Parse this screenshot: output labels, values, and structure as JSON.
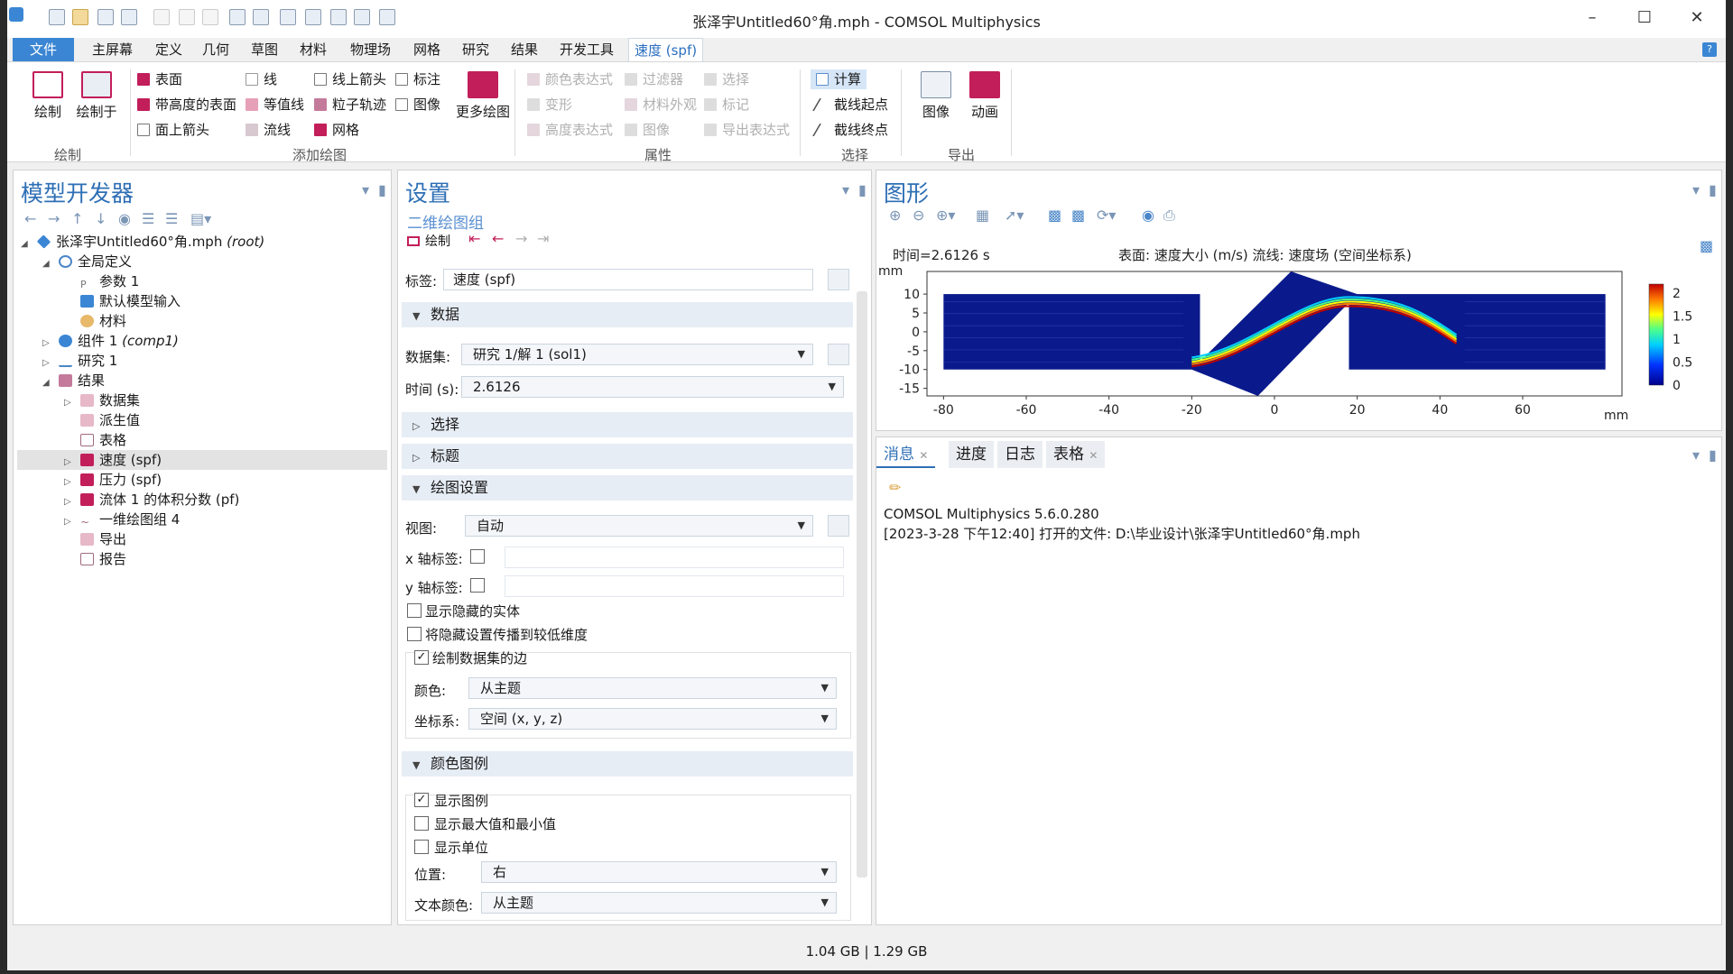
{
  "window": {
    "title": "张泽宇Untitled60°角.mph - COMSOL Multiphysics"
  },
  "menubar": {
    "file": "文件",
    "items": [
      "主屏幕",
      "定义",
      "几何",
      "草图",
      "材料",
      "物理场",
      "网格",
      "研究",
      "结果",
      "开发工具"
    ],
    "context_tab": "速度 (spf)"
  },
  "ribbon": {
    "plot": "绘制",
    "plot_in": "绘制于",
    "add_plot_items": [
      "表面",
      "线",
      "线上箭头",
      "标注",
      "带高度的表面",
      "等值线",
      "粒子轨迹",
      "图像",
      "面上箭头",
      "流线",
      "网格"
    ],
    "more_plots": "更多绘图",
    "attr_items": [
      "颜色表达式",
      "过滤器",
      "选择",
      "变形",
      "材料外观",
      "标记",
      "高度表达式",
      "图像",
      "导出表达式"
    ],
    "select_items": [
      "计算",
      "截线起点",
      "截线终点"
    ],
    "export_items": [
      "图像",
      "动画"
    ],
    "groups": {
      "plot": "绘制",
      "add_plot": "添加绘图",
      "attributes": "属性",
      "selection": "选择",
      "export": "导出"
    }
  },
  "model_builder": {
    "title": "模型开发器",
    "tree": [
      {
        "label": "张泽宇Untitled60°角.mph",
        "suffix": "(root)"
      },
      {
        "label": "全局定义"
      },
      {
        "label": "参数 1"
      },
      {
        "label": "默认模型输入"
      },
      {
        "label": "材料"
      },
      {
        "label": "组件 1",
        "suffix": "(comp1)"
      },
      {
        "label": "研究 1"
      },
      {
        "label": "结果"
      },
      {
        "label": "数据集"
      },
      {
        "label": "派生值"
      },
      {
        "label": "表格"
      },
      {
        "label": "速度 (spf)"
      },
      {
        "label": "压力 (spf)"
      },
      {
        "label": "流体 1 的体积分数 (pf)"
      },
      {
        "label": "一维绘图组 4"
      },
      {
        "label": "导出"
      },
      {
        "label": "报告"
      }
    ]
  },
  "settings": {
    "title": "设置",
    "subtitle": "二维绘图组",
    "plot_btn": "绘制",
    "label_caption": "标签:",
    "label_value": "速度 (spf)",
    "sections": {
      "data": "数据",
      "selection": "选择",
      "title": "标题",
      "plot_settings": "绘图设置",
      "color_legend": "颜色图例"
    },
    "dataset_caption": "数据集:",
    "dataset_value": "研究 1/解 1 (sol1)",
    "time_caption": "时间 (s):",
    "time_value": "2.6126",
    "view_caption": "视图:",
    "view_value": "自动",
    "xlabel_caption": "x 轴标签:",
    "ylabel_caption": "y 轴标签:",
    "show_hidden": "显示隐藏的实体",
    "propagate_hidden": "将隐藏设置传播到较低维度",
    "plot_dataset_edges": "绘制数据集的边",
    "color_caption": "颜色:",
    "color_value": "从主题",
    "coord_caption": "坐标系:",
    "coord_value": "空间 (x, y, z)",
    "show_legend": "显示图例",
    "show_minmax": "显示最大值和最小值",
    "show_units": "显示单位",
    "position_caption": "位置:",
    "position_value": "右",
    "textcolor_caption": "文本颜色:",
    "textcolor_value": "从主题"
  },
  "graphics": {
    "title": "图形",
    "time_text": "时间=2.6126 s",
    "surface_text": "表面: 速度大小 (m/s)  流线: 速度场  (空间坐标系)"
  },
  "chart_data": {
    "type": "heatmap",
    "xunit": "mm",
    "yunit": "mm",
    "xticks": [
      -80,
      -60,
      -40,
      -20,
      0,
      20,
      40,
      60
    ],
    "yticks": [
      10,
      5,
      0,
      -5,
      -10,
      -15
    ],
    "xlim": [
      -84,
      84
    ],
    "ylim": [
      -17,
      16
    ],
    "colorbar_ticks": [
      2,
      1.5,
      1,
      0.5,
      0
    ],
    "colorbar_range": [
      0,
      2.2
    ]
  },
  "messages": {
    "tabs": [
      "消息",
      "进度",
      "日志",
      "表格"
    ],
    "lines": [
      "COMSOL Multiphysics 5.6.0.280",
      "[2023-3-28 下午12:40] 打开的文件: D:\\毕业设计\\张泽宇Untitled60°角.mph"
    ]
  },
  "status": {
    "memory": "1.04 GB | 1.29 GB"
  },
  "colors": {
    "accent": "#3b86d4",
    "title_blue": "#2e6fb5",
    "plot_field": "#0a1a8c"
  }
}
